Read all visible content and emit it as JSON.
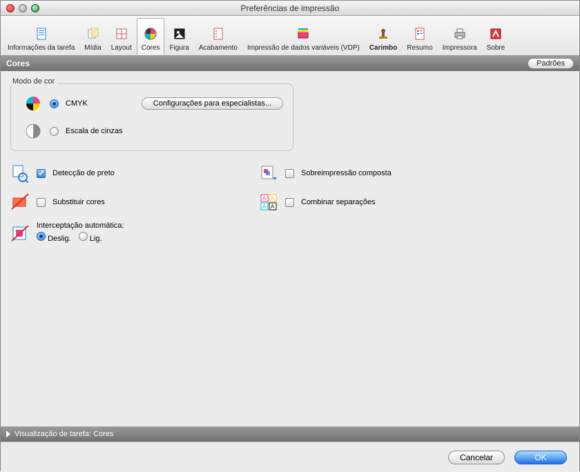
{
  "window": {
    "title": "Preferências de impressão"
  },
  "toolbar": {
    "items": [
      {
        "label": "Informações da tarefa",
        "bold": false,
        "selected": false
      },
      {
        "label": "Mídia",
        "bold": false,
        "selected": false
      },
      {
        "label": "Layout",
        "bold": false,
        "selected": false
      },
      {
        "label": "Cores",
        "bold": false,
        "selected": true
      },
      {
        "label": "Figura",
        "bold": false,
        "selected": false
      },
      {
        "label": "Acabamento",
        "bold": false,
        "selected": false
      },
      {
        "label": "Impressão de dados variáveis (VDP)",
        "bold": false,
        "selected": false
      },
      {
        "label": "Carimbo",
        "bold": true,
        "selected": false
      },
      {
        "label": "Resumo",
        "bold": false,
        "selected": false
      },
      {
        "label": "Impressora",
        "bold": false,
        "selected": false
      },
      {
        "label": "Sobre",
        "bold": false,
        "selected": false
      }
    ]
  },
  "section": {
    "title": "Cores",
    "defaults_button": "Padrões"
  },
  "color_mode": {
    "group_label": "Modo de cor",
    "cmyk": "CMYK",
    "grayscale": "Escala de cinzas",
    "selected": "cmyk",
    "expert_button": "Configurações para especialistas..."
  },
  "options": {
    "black_detection": {
      "label": "Detecção de preto",
      "checked": true
    },
    "composite_overprint": {
      "label": "Sobreimpressão composta",
      "checked": false
    },
    "substitute_colors": {
      "label": "Substituir cores",
      "checked": false
    },
    "combine_separations": {
      "label": "Combinar separações",
      "checked": false
    }
  },
  "autotrap": {
    "label": "Interceptação automática:",
    "off": "Deslig.",
    "on": "Lig.",
    "selected": "off"
  },
  "preview": {
    "label": "Visualização de tarefa: Cores"
  },
  "buttons": {
    "cancel": "Cancelar",
    "ok": "OK"
  }
}
